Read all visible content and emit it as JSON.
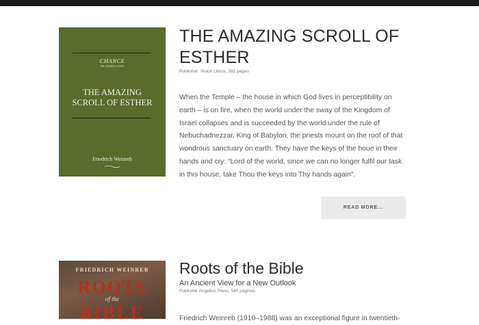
{
  "books": [
    {
      "cover": {
        "series": "CHANCE",
        "series_sub": "the Hidden Level",
        "title_line1": "THE AMAZING",
        "title_line2": "SCROLL OF ESTHER",
        "author": "Friedrich Weinreb",
        "color": "#5a6b2c"
      },
      "title": "THE AMAZING SCROLL OF ESTHER",
      "publisher": "Publisher: Vision Libros, 282 pages",
      "description": "When the Temple – the house in which God lives in perceptibility on earth – is on fire, when the world under the sway of the Kingdom of Israel collapses and is succeeded by the world under the rule of Nebuchadnezzar, King of Babylon, the priests mount on the roof of that wondrous sanctuary on earth. They have the keys of the houe in their hands and cry: “Lord of the world, since we can no longer fulfil our task in this house, take Thou the keys into Thy hands again”.",
      "read_more": "READ MORE..."
    },
    {
      "cover": {
        "author": "FRIEDRICH WEINREB",
        "title_line1": "ROOTS",
        "title_mid": "of the",
        "title_line2": "BIBLE"
      },
      "title": "Roots of the Bible",
      "subtitle": "An Ancient View for a New Outlook",
      "publisher": "Publisher Angelico Press, 540 páginas",
      "description": "Friedrich Weinreb (1910–1988) was an exceptional figure in twentieth-"
    }
  ]
}
